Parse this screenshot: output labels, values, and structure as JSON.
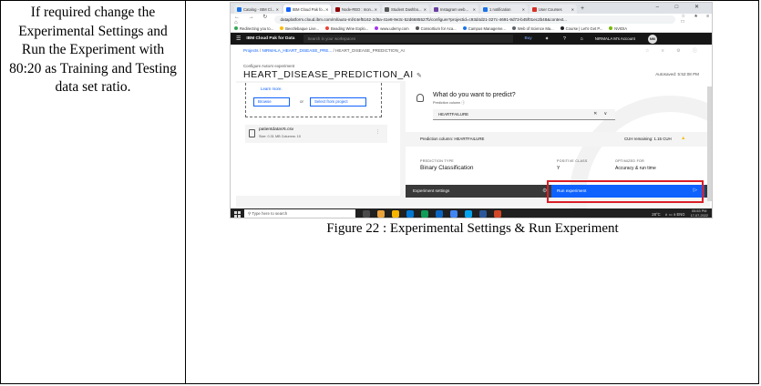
{
  "document": {
    "instruction": "If required change the Experimental Settings and Run the Experiment with 80:20 as Training and Testing data set ratio.",
    "caption": "Figure 22 : Experimental Settings & Run Experiment"
  },
  "browser": {
    "tabs": [
      {
        "label": "Catalog - IBM Cl...",
        "color": "#1a73e8"
      },
      {
        "label": "IBM Cloud Pak fo...",
        "color": "#0f62fe",
        "active": true
      },
      {
        "label": "Node-RED : mon...",
        "color": "#8f0000"
      },
      {
        "label": "Student Dashbo...",
        "color": "#555555"
      },
      {
        "label": "Instagram web...",
        "color": "#6b3fa0"
      },
      {
        "label": "1 notification",
        "color": "#1a73e8"
      },
      {
        "label": "User Courses",
        "color": "#d93025"
      }
    ],
    "new_tab": "+",
    "window_controls": "– □ ✕",
    "nav": "← → ↻ ⌂",
    "url": "dataplatform.cloud.ibm.com/ml/auto-ml/44ef5162-2d5a-41e8-9e3c-52d6685527b/configure?projectid=c93d4d21-327c-4691-9d73-b45f01ec2b48&context...",
    "addr_icons": "☆ ★ ≡ □",
    "bookmarks": [
      {
        "label": "Redirecting you to...",
        "color": "#34a853"
      },
      {
        "label": "Beezlebaque Live...",
        "color": "#fbbc05"
      },
      {
        "label": "Beading Wine Explo...",
        "color": "#ea4335"
      },
      {
        "label": "www.udemy.com",
        "color": "#a435f0"
      },
      {
        "label": "Consortium for Aca...",
        "color": "#555555"
      },
      {
        "label": "Campus Manageme...",
        "color": "#1a73e8"
      },
      {
        "label": "Web of Science Ma...",
        "color": "#5f6368"
      },
      {
        "label": "Course | Let's Get P...",
        "color": "#202124"
      },
      {
        "label": "NVIDIA",
        "color": "#76b900"
      }
    ]
  },
  "ibm": {
    "brand": "IBM Cloud Pak for Data",
    "search_placeholder": "Search in your workspaces",
    "buy": "Buy",
    "header_icons": "✦ ? ⌂",
    "account": "NIRMALA M's Account",
    "avatar": "NM",
    "breadcrumb": {
      "projects": "Projects",
      "project": "NIRMALA_HEART_DISEASE_PRE...",
      "current": "HEART_DISEASE_PREDICTION_AI"
    },
    "crumb_icons": "☆ ≡ ⚙ ⓘ",
    "configure_label": "Configure AutoAI experiment",
    "experiment_title": "HEART_DISEASE_PREDICTION_AI",
    "edit_icon": "✎",
    "autosaved": "Autosaved: 5:52:08 PM"
  },
  "left_panel": {
    "learn_more": "Learn more.",
    "browse": "Browse",
    "or": "or",
    "select_from_project": "Select from project",
    "file_name": "patientdataV6.csv",
    "file_meta": "Size: 0.31 MB     Columns: 10",
    "file_menu": "⋮"
  },
  "right_panel": {
    "question": "What do you want to predict?",
    "prediction_column_label": "Prediction column  ⓘ",
    "prediction_value": "HEARTFAILURE",
    "select_controls": "✕ ∨",
    "prediction_column_text": "Prediction column: HEARTFAILURE",
    "cuh_text": "CUH remaining:  1.15 CUH",
    "warn_icon": "▲",
    "prediction_type_label": "PREDICTION TYPE",
    "prediction_type": "Binary Classification",
    "positive_class_label": "POSITIVE CLASS",
    "positive_class": "Y",
    "optimized_for_label": "OPTIMIZED FOR",
    "optimized_for": "Accuracy & run time",
    "experiment_settings": "Experiment settings",
    "gear_icon": "⚙",
    "run_experiment": "Run experiment",
    "play_icon": "▷"
  },
  "taskbar": {
    "search_placeholder": "Type here to search",
    "weather": "28°C",
    "tray": "∧ ▭ ə ENG",
    "time": "05:53 PM",
    "date": "17-07-2022",
    "apps": [
      "#4a4a4a",
      "#e8a33d",
      "#f7b500",
      "#0078d4",
      "#0f9d58",
      "#0a66c2",
      "#4285f4",
      "#00a4ef",
      "#2b579a",
      "#d24726"
    ]
  },
  "colors": {
    "ibm_blue": "#0f62fe",
    "highlight_red": "#da1e28",
    "ibm_header": "#161616"
  }
}
